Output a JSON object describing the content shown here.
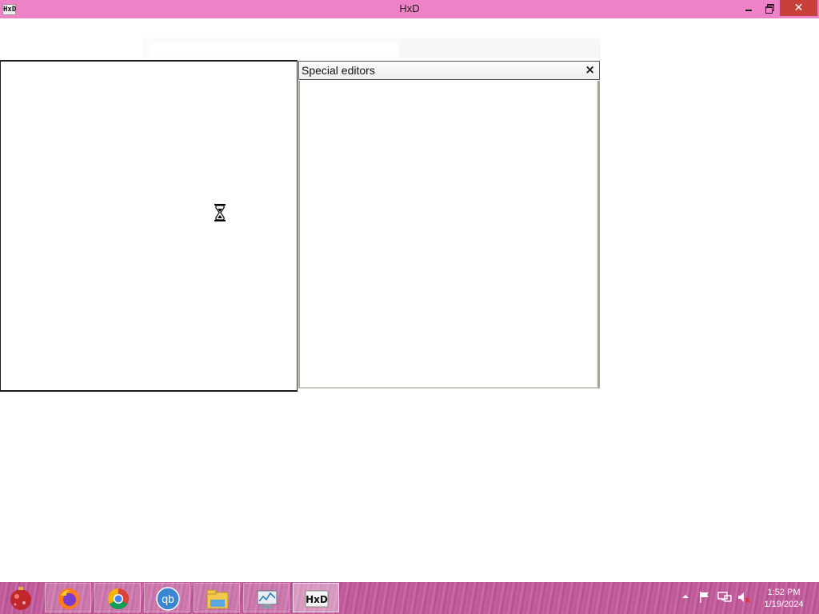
{
  "window": {
    "title": "HxD",
    "icon_text": "HxD",
    "controls": {
      "minimize": "",
      "restore": "",
      "close": "✕"
    },
    "titlebar_color": "#ee82c6",
    "close_color": "#c7413a"
  },
  "special_editors": {
    "title": "Special editors",
    "close_glyph": "×"
  },
  "cursor": {
    "type": "hourglass-icon"
  },
  "taskbar": {
    "start_icon": "start-orb-icon",
    "apps": [
      {
        "name": "firefox-icon",
        "active": false
      },
      {
        "name": "chrome-icon",
        "active": false
      },
      {
        "name": "qbittorrent-icon",
        "label": "qb",
        "active": false
      },
      {
        "name": "file-explorer-icon",
        "active": false
      },
      {
        "name": "resource-monitor-icon",
        "active": false
      },
      {
        "name": "hxd-icon",
        "label": "HxD",
        "active": true
      }
    ],
    "tray": [
      {
        "name": "show-hidden-icons-icon"
      },
      {
        "name": "action-center-flag-icon"
      },
      {
        "name": "network-icon"
      },
      {
        "name": "volume-muted-icon"
      }
    ],
    "clock": {
      "time": "1:52 PM",
      "date": "1/19/2024"
    }
  }
}
